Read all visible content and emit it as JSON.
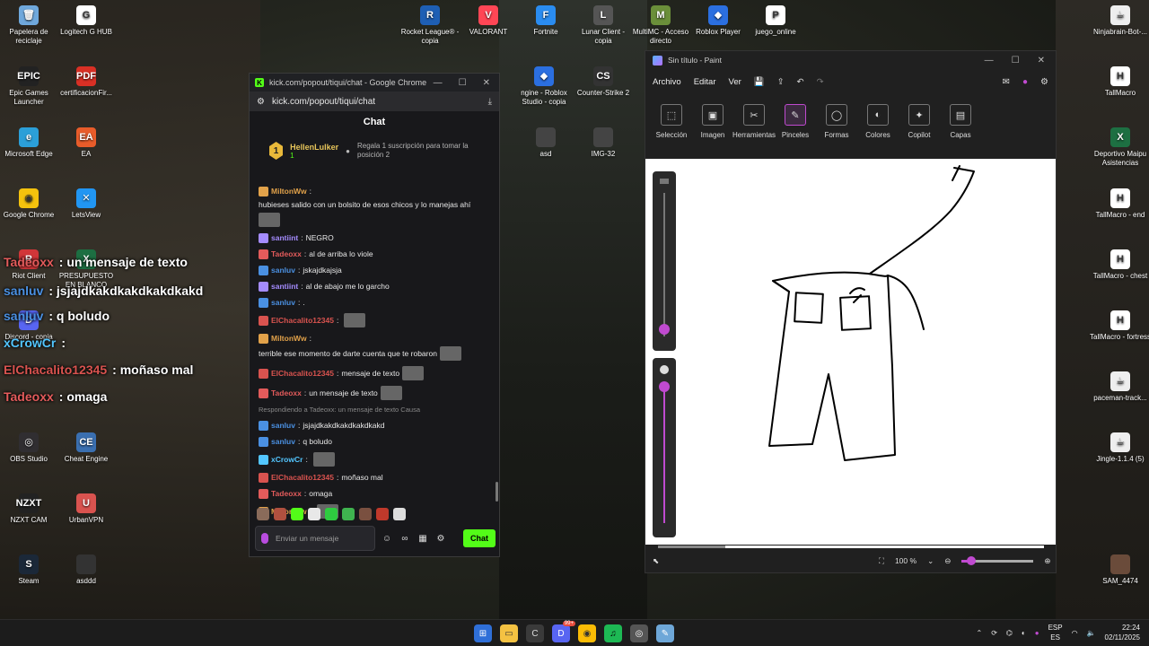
{
  "desktop": {
    "icons_left": [
      {
        "label": "Papelera de reciclaje",
        "color": "#6fa8dc",
        "glyph": "🗑"
      },
      {
        "label": "Logitech G HUB",
        "color": "#ffffff",
        "glyph": "G"
      },
      {
        "label": "Epic Games Launcher",
        "color": "#222222",
        "glyph": "EPIC"
      },
      {
        "label": "certificacionFir...",
        "color": "#d93025",
        "glyph": "PDF"
      },
      {
        "label": "Microsoft Edge",
        "color": "#2b9fd8",
        "glyph": "e"
      },
      {
        "label": "EA",
        "color": "#e85c2a",
        "glyph": "EA"
      },
      {
        "label": "Google Chrome",
        "color": "#f4c20d",
        "glyph": "◉"
      },
      {
        "label": "LetsView",
        "color": "#2196f3",
        "glyph": "✕"
      },
      {
        "label": "Riot Client",
        "color": "#d13639",
        "glyph": "R"
      },
      {
        "label": "PRESUPUESTO EN BLANCO",
        "color": "#1d6f42",
        "glyph": "X"
      },
      {
        "label": "Discord - copia",
        "color": "#5865f2",
        "glyph": "D"
      },
      {
        "label": "OBS Studio",
        "color": "#302e31",
        "glyph": "◎"
      },
      {
        "label": "Cheat Engine",
        "color": "#3a6fb0",
        "glyph": "CE"
      },
      {
        "label": "NZXT CAM",
        "color": "#222222",
        "glyph": "NZXT"
      },
      {
        "label": "UrbanVPN",
        "color": "#d9534f",
        "glyph": "U"
      },
      {
        "label": "Steam",
        "color": "#1b2838",
        "glyph": "S"
      },
      {
        "label": "asddd",
        "color": "#333333",
        "glyph": ""
      }
    ],
    "icons_top": [
      {
        "label": "Rocket League® - copia",
        "color": "#1e5fb4",
        "glyph": "R"
      },
      {
        "label": "VALORANT",
        "color": "#ff4655",
        "glyph": "V"
      },
      {
        "label": "Fortnite",
        "color": "#2a8cf0",
        "glyph": "F"
      },
      {
        "label": "Lunar Client - copia",
        "color": "#555555",
        "glyph": "L"
      },
      {
        "label": "MultiMC - Acceso directo",
        "color": "#6b8f3a",
        "glyph": "M"
      },
      {
        "label": "Roblox Player",
        "color": "#2b6fe0",
        "glyph": "◆"
      },
      {
        "label": "juego_online",
        "color": "#ffffff",
        "glyph": "P"
      }
    ],
    "icons_mid": [
      {
        "label": "ngine - Roblox Studio - copia",
        "color": "#2b6fe0",
        "glyph": "◆"
      },
      {
        "label": "Counter-Strike 2",
        "color": "#333333",
        "glyph": "CS"
      },
      {
        "label": "asd",
        "color": "#444444",
        "glyph": ""
      },
      {
        "label": "IMG-32",
        "color": "#444444",
        "glyph": ""
      }
    ],
    "icons_right": [
      {
        "label": "Ninjabrain-Bot-...",
        "color": "#eeeeee",
        "glyph": "☕"
      },
      {
        "label": "TallMacro",
        "color": "#ffffff",
        "glyph": "H"
      },
      {
        "label": "Deportivo Maipu Asistencias",
        "color": "#1d6f42",
        "glyph": "X"
      },
      {
        "label": "TallMacro - end",
        "color": "#ffffff",
        "glyph": "H"
      },
      {
        "label": "TallMacro - chest",
        "color": "#ffffff",
        "glyph": "H"
      },
      {
        "label": "TallMacro - fortress",
        "color": "#ffffff",
        "glyph": "H"
      },
      {
        "label": "paceman-track...",
        "color": "#eeeeee",
        "glyph": "☕"
      },
      {
        "label": "Jingle-1.1.4 (5)",
        "color": "#eeeeee",
        "glyph": "☕"
      },
      {
        "label": "SAM_4474",
        "color": "#6a4b3a",
        "glyph": ""
      }
    ],
    "overlay_chat": [
      {
        "user": "Tadeoxx",
        "text": ": un mensaje de texto",
        "color": "#e35b5b"
      },
      {
        "user": "sanluv",
        "text": ": jsjajdkakdkakdkakdkakd",
        "color": "#4a90e2"
      },
      {
        "user": "sanluv",
        "text": ": q boludo",
        "color": "#4a90e2"
      },
      {
        "user": "xCrowCr",
        "text": ":",
        "color": "#53c6ff"
      },
      {
        "user": "ElChacalito12345",
        "text": ": moñaso mal",
        "color": "#d9534f"
      },
      {
        "user": "Tadeoxx",
        "text": ": omaga",
        "color": "#e35b5b"
      }
    ]
  },
  "chrome": {
    "title": "kick.com/popout/tiqui/chat - Google Chrome",
    "url": "kick.com/popout/tiqui/chat",
    "chat_header": "Chat",
    "pinned": {
      "rank": "1",
      "user": "HellenLulker",
      "count": "1",
      "message": "Regala 1 suscripción para tomar la posición 2"
    },
    "messages": [
      {
        "user": "MiltonWw",
        "color": "#e2a24a",
        "text": "hubieses salido con un bolsito de esos chicos y lo manejas ahí"
      },
      {
        "user": "santiint",
        "color": "#a58cff",
        "text": "NEGRO"
      },
      {
        "user": "Tadeoxx",
        "color": "#e35b5b",
        "text": "al de arriba lo viole"
      },
      {
        "user": "sanluv",
        "color": "#4a90e2",
        "text": "jskajdkajsja"
      },
      {
        "user": "santiint",
        "color": "#a58cff",
        "text": "al de abajo me lo garcho"
      },
      {
        "user": "sanluv",
        "color": "#4a90e2",
        "text": "."
      },
      {
        "user": "ElChacalito12345",
        "color": "#d9534f",
        "text": ""
      },
      {
        "user": "MiltonWw",
        "color": "#e2a24a",
        "text": "terrible ese momento de darte cuenta que te robaron"
      },
      {
        "user": "ElChacalito12345",
        "color": "#d9534f",
        "text": "mensaje de texto"
      },
      {
        "user": "Tadeoxx",
        "color": "#e35b5b",
        "text": "un mensaje de texto"
      },
      {
        "user": "sanluv",
        "color": "#4a90e2",
        "text": "jsjajdkakdkakdkakdkakd"
      },
      {
        "user": "sanluv",
        "color": "#4a90e2",
        "text": "q boludo"
      },
      {
        "user": "xCrowCr",
        "color": "#53c6ff",
        "text": ""
      },
      {
        "user": "ElChacalito12345",
        "color": "#d9534f",
        "text": "moñaso mal"
      },
      {
        "user": "Tadeoxx",
        "color": "#e35b5b",
        "text": "omaga"
      },
      {
        "user": "MiltonWw",
        "color": "#e2a24a",
        "text": ""
      }
    ],
    "reply_note": "Respondiendo a Tadeoxx: un mensaje de texto Causa",
    "input_placeholder": "Enviar un mensaje",
    "send_label": "Chat"
  },
  "paint": {
    "title": "Sin título - Paint",
    "menu": [
      "Archivo",
      "Editar",
      "Ver"
    ],
    "ribbon": [
      "Selección",
      "Imagen",
      "Herramientas",
      "Pinceles",
      "Formas",
      "Colores",
      "Copilot",
      "Capas"
    ],
    "selected_tool": "Pinceles",
    "zoom": "100 %",
    "brush_size_level": 0.05,
    "opacity_level": 0.95
  },
  "taskbar": {
    "lang_top": "ESP",
    "lang_bottom": "ES",
    "time": "22:24",
    "date": "02/11/2025",
    "discord_badge": "99+"
  }
}
